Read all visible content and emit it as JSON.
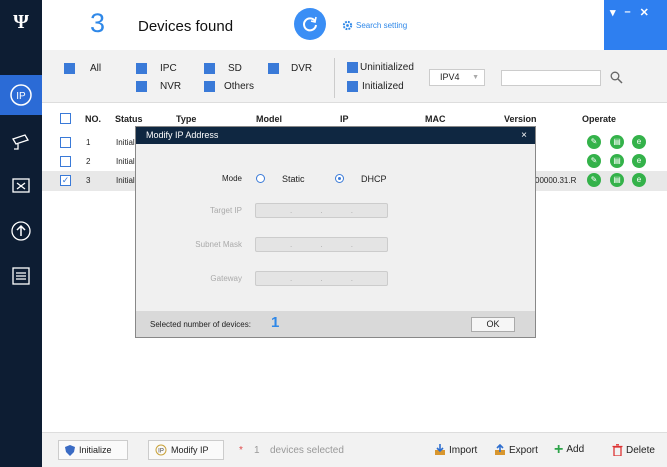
{
  "header": {
    "count": "3",
    "found_label": "Devices found",
    "search_setting": "Search setting"
  },
  "window_controls": [
    "▾",
    "–",
    "✕"
  ],
  "filters": {
    "all": "All",
    "ipc": "IPC",
    "sd": "SD",
    "dvr": "DVR",
    "nvr": "NVR",
    "others": "Others",
    "uninitialized": "Uninitialized",
    "initialized": "Initialized",
    "ip_version": "IPV4"
  },
  "table": {
    "headers": [
      "NO.",
      "Status",
      "Type",
      "Model",
      "IP",
      "MAC",
      "Version",
      "Operate"
    ],
    "rows": [
      {
        "no": "1",
        "status": "Initial",
        "version": ""
      },
      {
        "no": "2",
        "status": "Initial",
        "version": ""
      },
      {
        "no": "3",
        "status": "Initial",
        "version": "00000.31.R"
      }
    ]
  },
  "dialog": {
    "title": "Modify IP Address",
    "close": "×",
    "mode_label": "Mode",
    "static_label": "Static",
    "dhcp_label": "DHCP",
    "target_ip_label": "Target IP",
    "subnet_mask_label": "Subnet Mask",
    "gateway_label": "Gateway",
    "selected_label": "Selected number of devices:",
    "selected_count": "1",
    "ok": "OK"
  },
  "bottom": {
    "initialize": "Initialize",
    "modify_ip": "Modify IP",
    "star": "*",
    "selected_count": "1",
    "devices_selected": "devices selected",
    "import": "Import",
    "export": "Export",
    "add": "Add",
    "delete": "Delete"
  },
  "colors": {
    "accent": "#2f88e8",
    "sidebar": "#0d1d33",
    "dialog_title": "#0f2741",
    "green": "#34b24a"
  }
}
